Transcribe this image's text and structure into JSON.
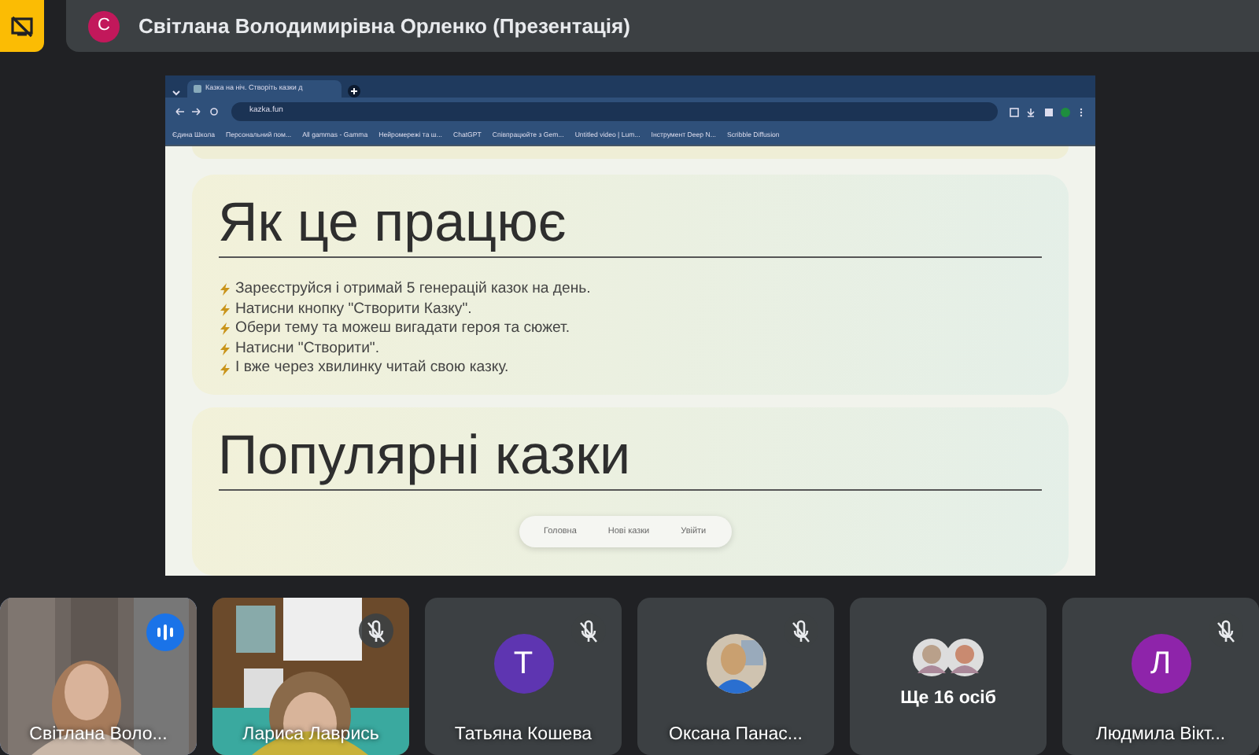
{
  "presenter": {
    "initial": "С",
    "color": "#c2185b",
    "name": "Світлана Володимирівна Орленко (Презентація)"
  },
  "browser": {
    "tab_title": "Казка на ніч. Створіть казки д",
    "url": "kazka.fun",
    "bookmarks": [
      "Єдина Школа",
      "Персональний пом...",
      "All gammas - Gamma",
      "Нейромережі та ш...",
      "ChatGPT",
      "Співпрацюйте з Gem...",
      "Untitled video | Lum...",
      "Інструмент Deep N...",
      "Scribble Diffusion"
    ]
  },
  "page": {
    "sections": [
      {
        "heading": "Як це працює",
        "steps": [
          "Зареєструйся і отримай 5 генерацій казок на день.",
          "Натисни кнопку \"Створити Казку\".",
          "Обери тему та можеш вигадати героя та сюжет.",
          "Натисни \"Створити\".",
          "І вже через хвилинку читай свою казку."
        ]
      },
      {
        "heading": "Популярні казки"
      }
    ],
    "nav": [
      "Головна",
      "Нові казки",
      "Увійти"
    ]
  },
  "participants": [
    {
      "kind": "video",
      "name": "Світлана Воло...",
      "speaking": true,
      "muted": false
    },
    {
      "kind": "video",
      "name": "Лариса Лаврись",
      "speaking": false,
      "muted": true
    },
    {
      "kind": "letter",
      "initial": "Т",
      "color": "#5e35b1",
      "name": "Татьяна Кошева",
      "speaking": false,
      "muted": true
    },
    {
      "name": "Оксана Панас...",
      "speaking": false,
      "muted": true
    },
    {
      "kind": "more",
      "label": "Ще 16 осіб"
    },
    {
      "kind": "letter",
      "initial": "Л",
      "color": "#8e24aa",
      "name": "Людмила Вікт...",
      "speaking": false,
      "muted": true
    }
  ]
}
